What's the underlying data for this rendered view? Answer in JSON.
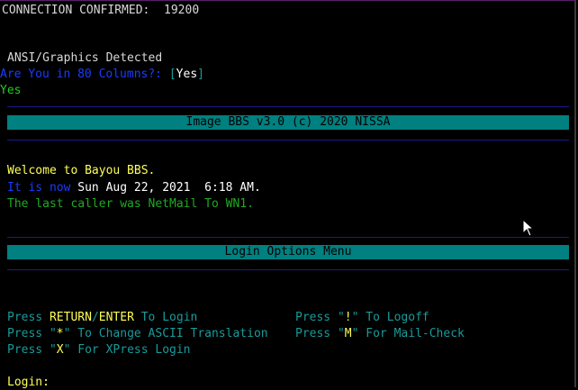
{
  "connection": {
    "label": "CONNECTION CONFIRMED:",
    "baud": "19200"
  },
  "detect": {
    "ansi": "ANSI/Graphics Detected",
    "columns_prompt": "Are You in 80 Columns?:",
    "bracket_open": "[",
    "default_answer": "Yes",
    "bracket_close": "]",
    "answer": "Yes"
  },
  "banner": {
    "title": "Image BBS v3.0 (c) 2020 NISSA"
  },
  "welcome": {
    "line": "Welcome to Bayou BBS.",
    "now_label": "It is now",
    "datetime": "Sun Aug 22, 2021  6:18 AM.",
    "last_caller": "The last caller was NetMail To WN1."
  },
  "menu": {
    "title": "Login Options Menu",
    "options": [
      {
        "pre": "Press ",
        "key": "RETURN",
        "sep": "/",
        "key2": "ENTER",
        "post": " To Login"
      },
      {
        "pre": "Press \"",
        "key": "!",
        "post": "\" To Logoff"
      },
      {
        "pre": "Press \"",
        "key": "*",
        "post": "\" To Change ASCII Translation"
      },
      {
        "pre": "Press \"",
        "key": "M",
        "post": "\" For Mail-Check"
      },
      {
        "pre": "Press \"",
        "key": "X",
        "post": "\" For XPress Login"
      }
    ]
  },
  "login": {
    "prompt": "Login:"
  },
  "colors": {
    "background": "#000000",
    "bar": "#008080",
    "rule": "#1a1a8a",
    "key_highlight": "#ffff55",
    "menu_text": "#1a9a9a"
  },
  "icons": {
    "cursor": "mouse-pointer-icon"
  }
}
